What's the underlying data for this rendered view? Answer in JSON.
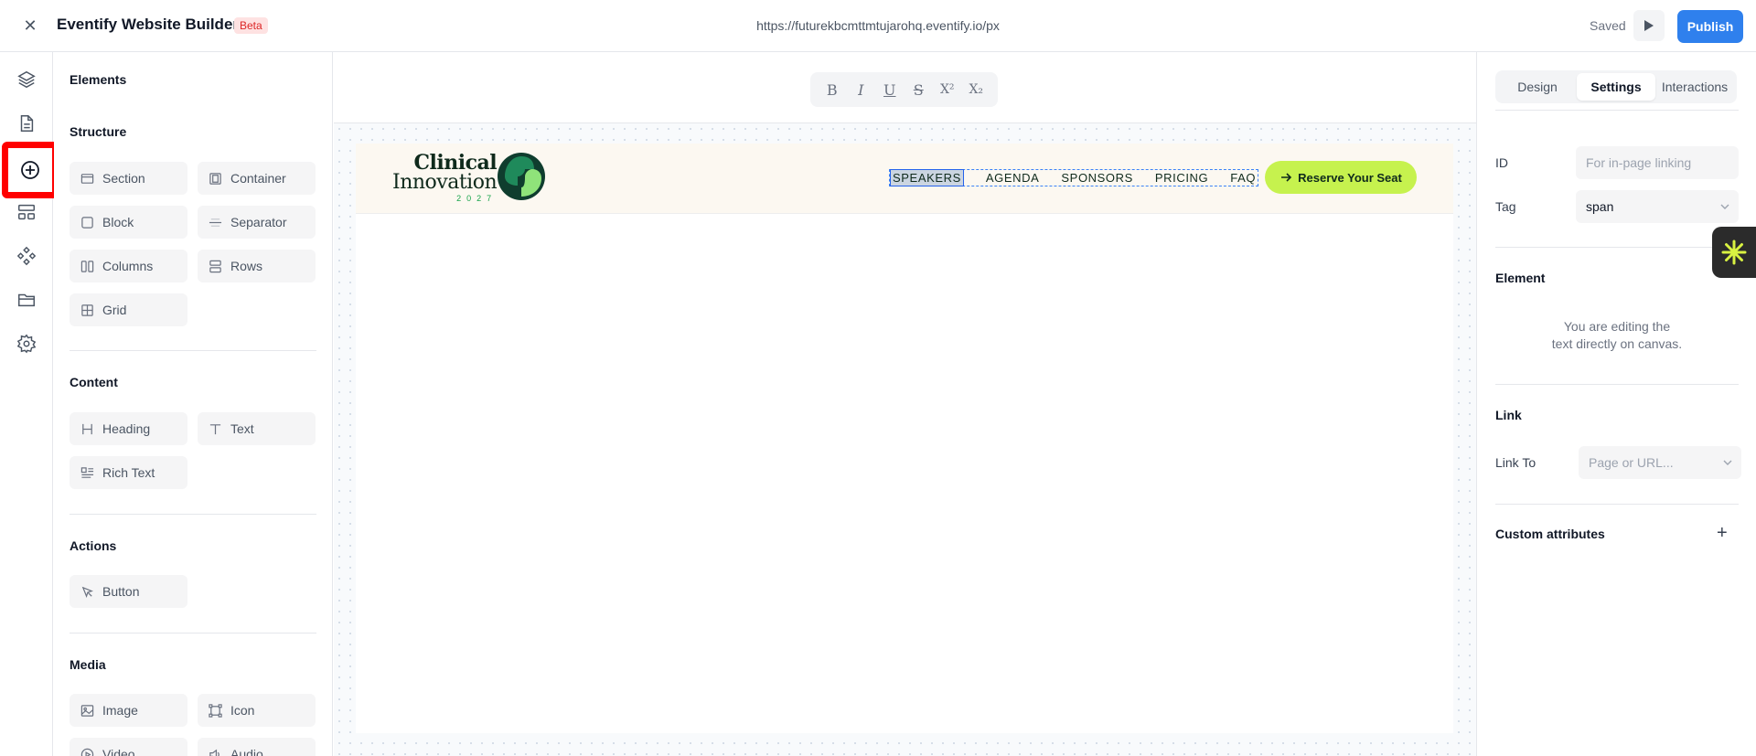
{
  "topbar": {
    "app_title": "Eventify Website Builder",
    "badge": "Beta",
    "url": "https://futurekbcmttmtujarohq.eventify.io/px",
    "status": "Saved",
    "publish_label": "Publish",
    "accent_color": "#2f80ed"
  },
  "rail": {
    "items": [
      "layers-icon",
      "page-icon",
      "add-element-icon",
      "sections-icon",
      "components-icon",
      "assets-folder-icon",
      "settings-icon"
    ],
    "active": "add-element-icon",
    "highlight_color": "#ff0000"
  },
  "elements_panel": {
    "title": "Elements",
    "structure": {
      "title": "Structure",
      "items": [
        "Section",
        "Container",
        "Block",
        "Separator",
        "Columns",
        "Rows",
        "Grid"
      ]
    },
    "content": {
      "title": "Content",
      "items": [
        "Heading",
        "Text",
        "Rich Text"
      ]
    },
    "actions": {
      "title": "Actions",
      "items": [
        "Button"
      ]
    },
    "media": {
      "title": "Media",
      "items": [
        "Image",
        "Icon",
        "Video",
        "Audio"
      ]
    }
  },
  "format_bar": {
    "buttons": [
      "B",
      "I",
      "U",
      "S",
      "X²",
      "X₂"
    ],
    "icons": [
      "bold-icon",
      "italic-icon",
      "underline-icon",
      "strikethrough-icon",
      "superscript-icon",
      "subscript-icon"
    ]
  },
  "site": {
    "logo_line1": "Clinical",
    "logo_line2": "Innovation",
    "logo_line3": "2027",
    "nav": [
      "SPEAKERS",
      "AGENDA",
      "SPONSORS",
      "PRICING",
      "FAQ"
    ],
    "selected_nav": "SPEAKERS",
    "cta": "Reserve Your Seat",
    "header_bg": "#fcf8f1",
    "cta_color": "#c6f24e"
  },
  "settings_panel": {
    "tabs": [
      "Design",
      "Settings",
      "Interactions"
    ],
    "active_tab": "Settings",
    "id_label": "ID",
    "id_placeholder": "For in-page linking",
    "tag_label": "Tag",
    "tag_value": "span",
    "element_heading": "Element",
    "element_note_line1": "You are editing the",
    "element_note_line2": "text directly on canvas.",
    "link_heading": "Link",
    "link_to_label": "Link To",
    "link_to_placeholder": "Page or URL...",
    "custom_attributes": "Custom attributes"
  }
}
